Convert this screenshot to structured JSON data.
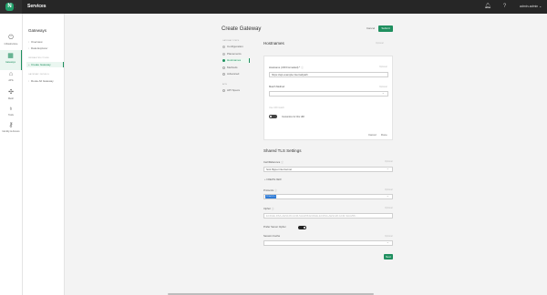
{
  "topbar": {
    "logo_letter": "N",
    "app_title": "Services",
    "user": "admin-admin",
    "icons": [
      "bell-icon",
      "help-icon",
      "chevron-down-icon"
    ]
  },
  "rail": {
    "items": [
      {
        "label": "Infrastructure",
        "icon": "infra-icon"
      },
      {
        "label": "Gateways",
        "icon": "gateway-icon"
      },
      {
        "label": "APIs",
        "icon": "api-icon"
      },
      {
        "label": "Mesh",
        "icon": "mesh-icon"
      },
      {
        "label": "Tools",
        "icon": "tools-icon"
      },
      {
        "label": "Identity & Access",
        "icon": "identity-icon"
      }
    ]
  },
  "subnav": {
    "title": "Gateways",
    "items": [
      "Overview",
      "Data Explorer"
    ],
    "section1": "INFRASTRUCTURE",
    "section1_items": [
      "Create Gateway"
    ],
    "section2": "GATEWAY DETAILS",
    "section2_items": [
      "Route All Gateway"
    ]
  },
  "page": {
    "title": "Create Gateway",
    "cancel": "Cancel",
    "submit": "Submit"
  },
  "steps": {
    "section1": "GATEWAY STEPS",
    "items": [
      "Configuration",
      "Placements",
      "Hostnames",
      "Methods",
      "Advanced"
    ],
    "section2": "APIS",
    "apis": [
      "API Specs"
    ]
  },
  "hostnames": {
    "title": "Hostnames",
    "optional": "Optional",
    "fqdn_label": "Hostname (URI Formatted) *",
    "fqdn_value": "https://api.example.internal/path",
    "fqdn_optional": "Optional",
    "match_label": "Match Method",
    "match_optional": "Optional",
    "match_value": "",
    "wildcard_label": "Use URI match",
    "customize_label": "Customize for this URI",
    "cancel": "Cancel",
    "done": "Done"
  },
  "tls": {
    "title": "Shared TLS Settings",
    "cert_label": "Cert/Reference",
    "cert_optional": "Optional",
    "cert_value": "host.flipper.internal.net",
    "create_new": "CREATE NEW",
    "protocols_label": "Protocols",
    "protocols_optional": "Optional",
    "protocol_chip": "TLSv1.3",
    "cipher_label": "Cipher",
    "cipher_optional": "Optional",
    "cipher_placeholder": "ECDHE-RSA-AES128-GCM-SHA256:ECDHE-ECDSA-AES128-GCM-SHA256:...",
    "prefer_label": "Prefer Server Cipher",
    "session_label": "Session Cache",
    "session_optional": "Optional",
    "session_value": "",
    "next": "Next"
  }
}
